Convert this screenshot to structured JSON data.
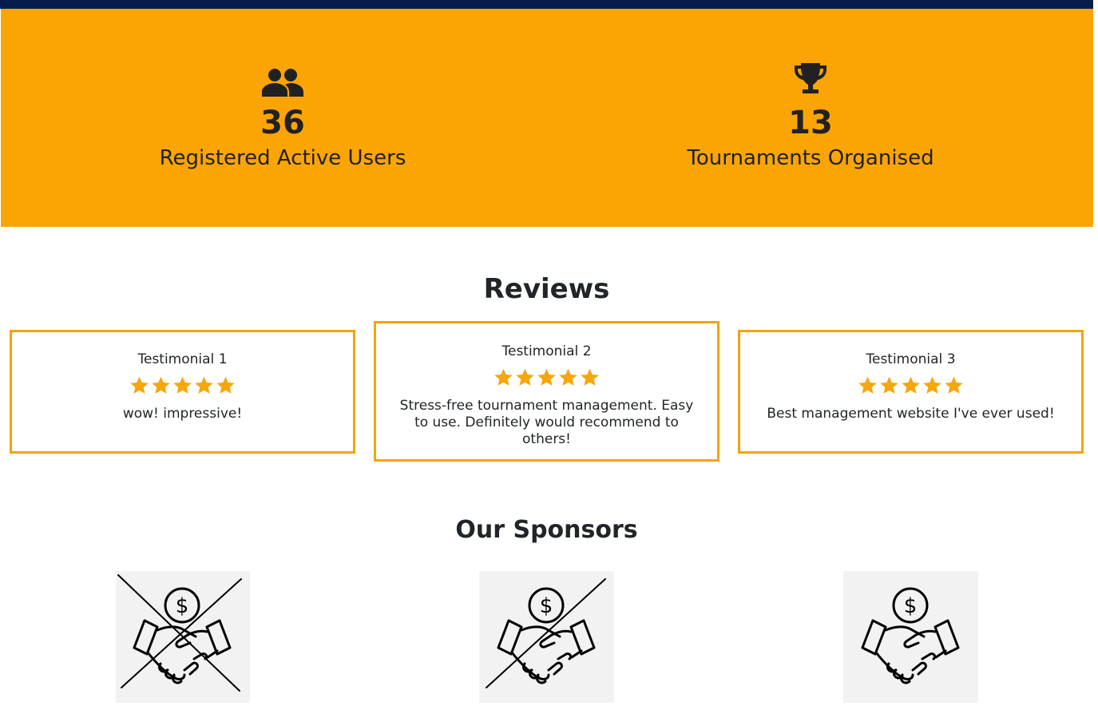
{
  "colors": {
    "topbar": "#041e4c",
    "stats_background": "#fba504",
    "card_border": "#f2a50c",
    "star": "#f5a70b"
  },
  "stats": [
    {
      "icon": "users-icon",
      "value": "36",
      "label": "Registered Active Users"
    },
    {
      "icon": "trophy-icon",
      "value": "13",
      "label": "Tournaments Organised"
    }
  ],
  "reviews": {
    "title": "Reviews",
    "items": [
      {
        "name": "Testimonial 1",
        "rating": 5,
        "text": "wow! impressive!"
      },
      {
        "name": "Testimonial 2",
        "rating": 5,
        "text": "Stress-free tournament management. Easy to use. Definitely would recommend to others!"
      },
      {
        "name": "Testimonial 3",
        "rating": 5,
        "text": "Best management website I've ever used!"
      }
    ]
  },
  "sponsors": {
    "title": "Our Sponsors",
    "items": [
      {
        "icon": "sponsor-handshake-crossed-icon"
      },
      {
        "icon": "sponsor-handshake-half-crossed-icon"
      },
      {
        "icon": "sponsor-handshake-icon"
      }
    ]
  }
}
